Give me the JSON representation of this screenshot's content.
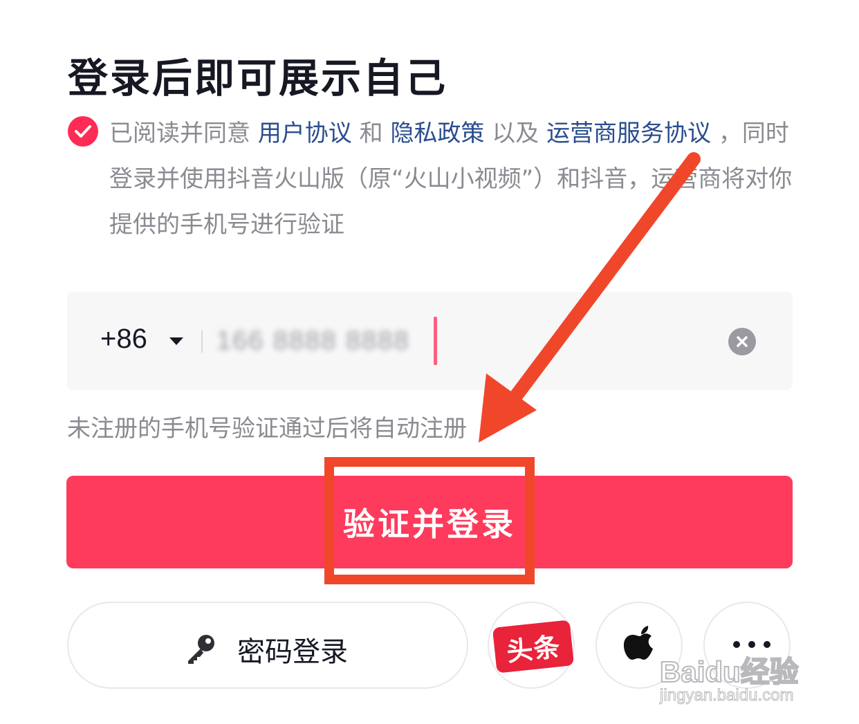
{
  "header": {
    "title": "登录后即可展示自己"
  },
  "agreement": {
    "checked": true,
    "prefix": "已阅读并同意 ",
    "link_user": "用户协议",
    "and": " 和 ",
    "link_privacy": "隐私政策",
    "also": " 以及 ",
    "link_carrier": "运营商服务协议",
    "suffix": " ，同时登录并使用抖音火山版（原“火山小视频”）和抖音，运营商将对你提供的手机号进行验证"
  },
  "phone_input": {
    "country_code": "+86",
    "value": "166 8888 8888",
    "clear_icon": "clear-icon"
  },
  "hint": "未注册的手机号验证通过后将自动注册",
  "login_button": {
    "label": "验证并登录",
    "color": "#fe3b5c"
  },
  "alt_login": {
    "password_label": "密码登录",
    "password_icon": "key-icon",
    "toutiao_label": "头条",
    "apple_icon": "apple-icon",
    "more_icon": "more-icon"
  },
  "annotation": {
    "color": "#f0472a"
  },
  "watermark": {
    "brand": "Baidu经验",
    "url": "jingyan.baidu.com"
  }
}
